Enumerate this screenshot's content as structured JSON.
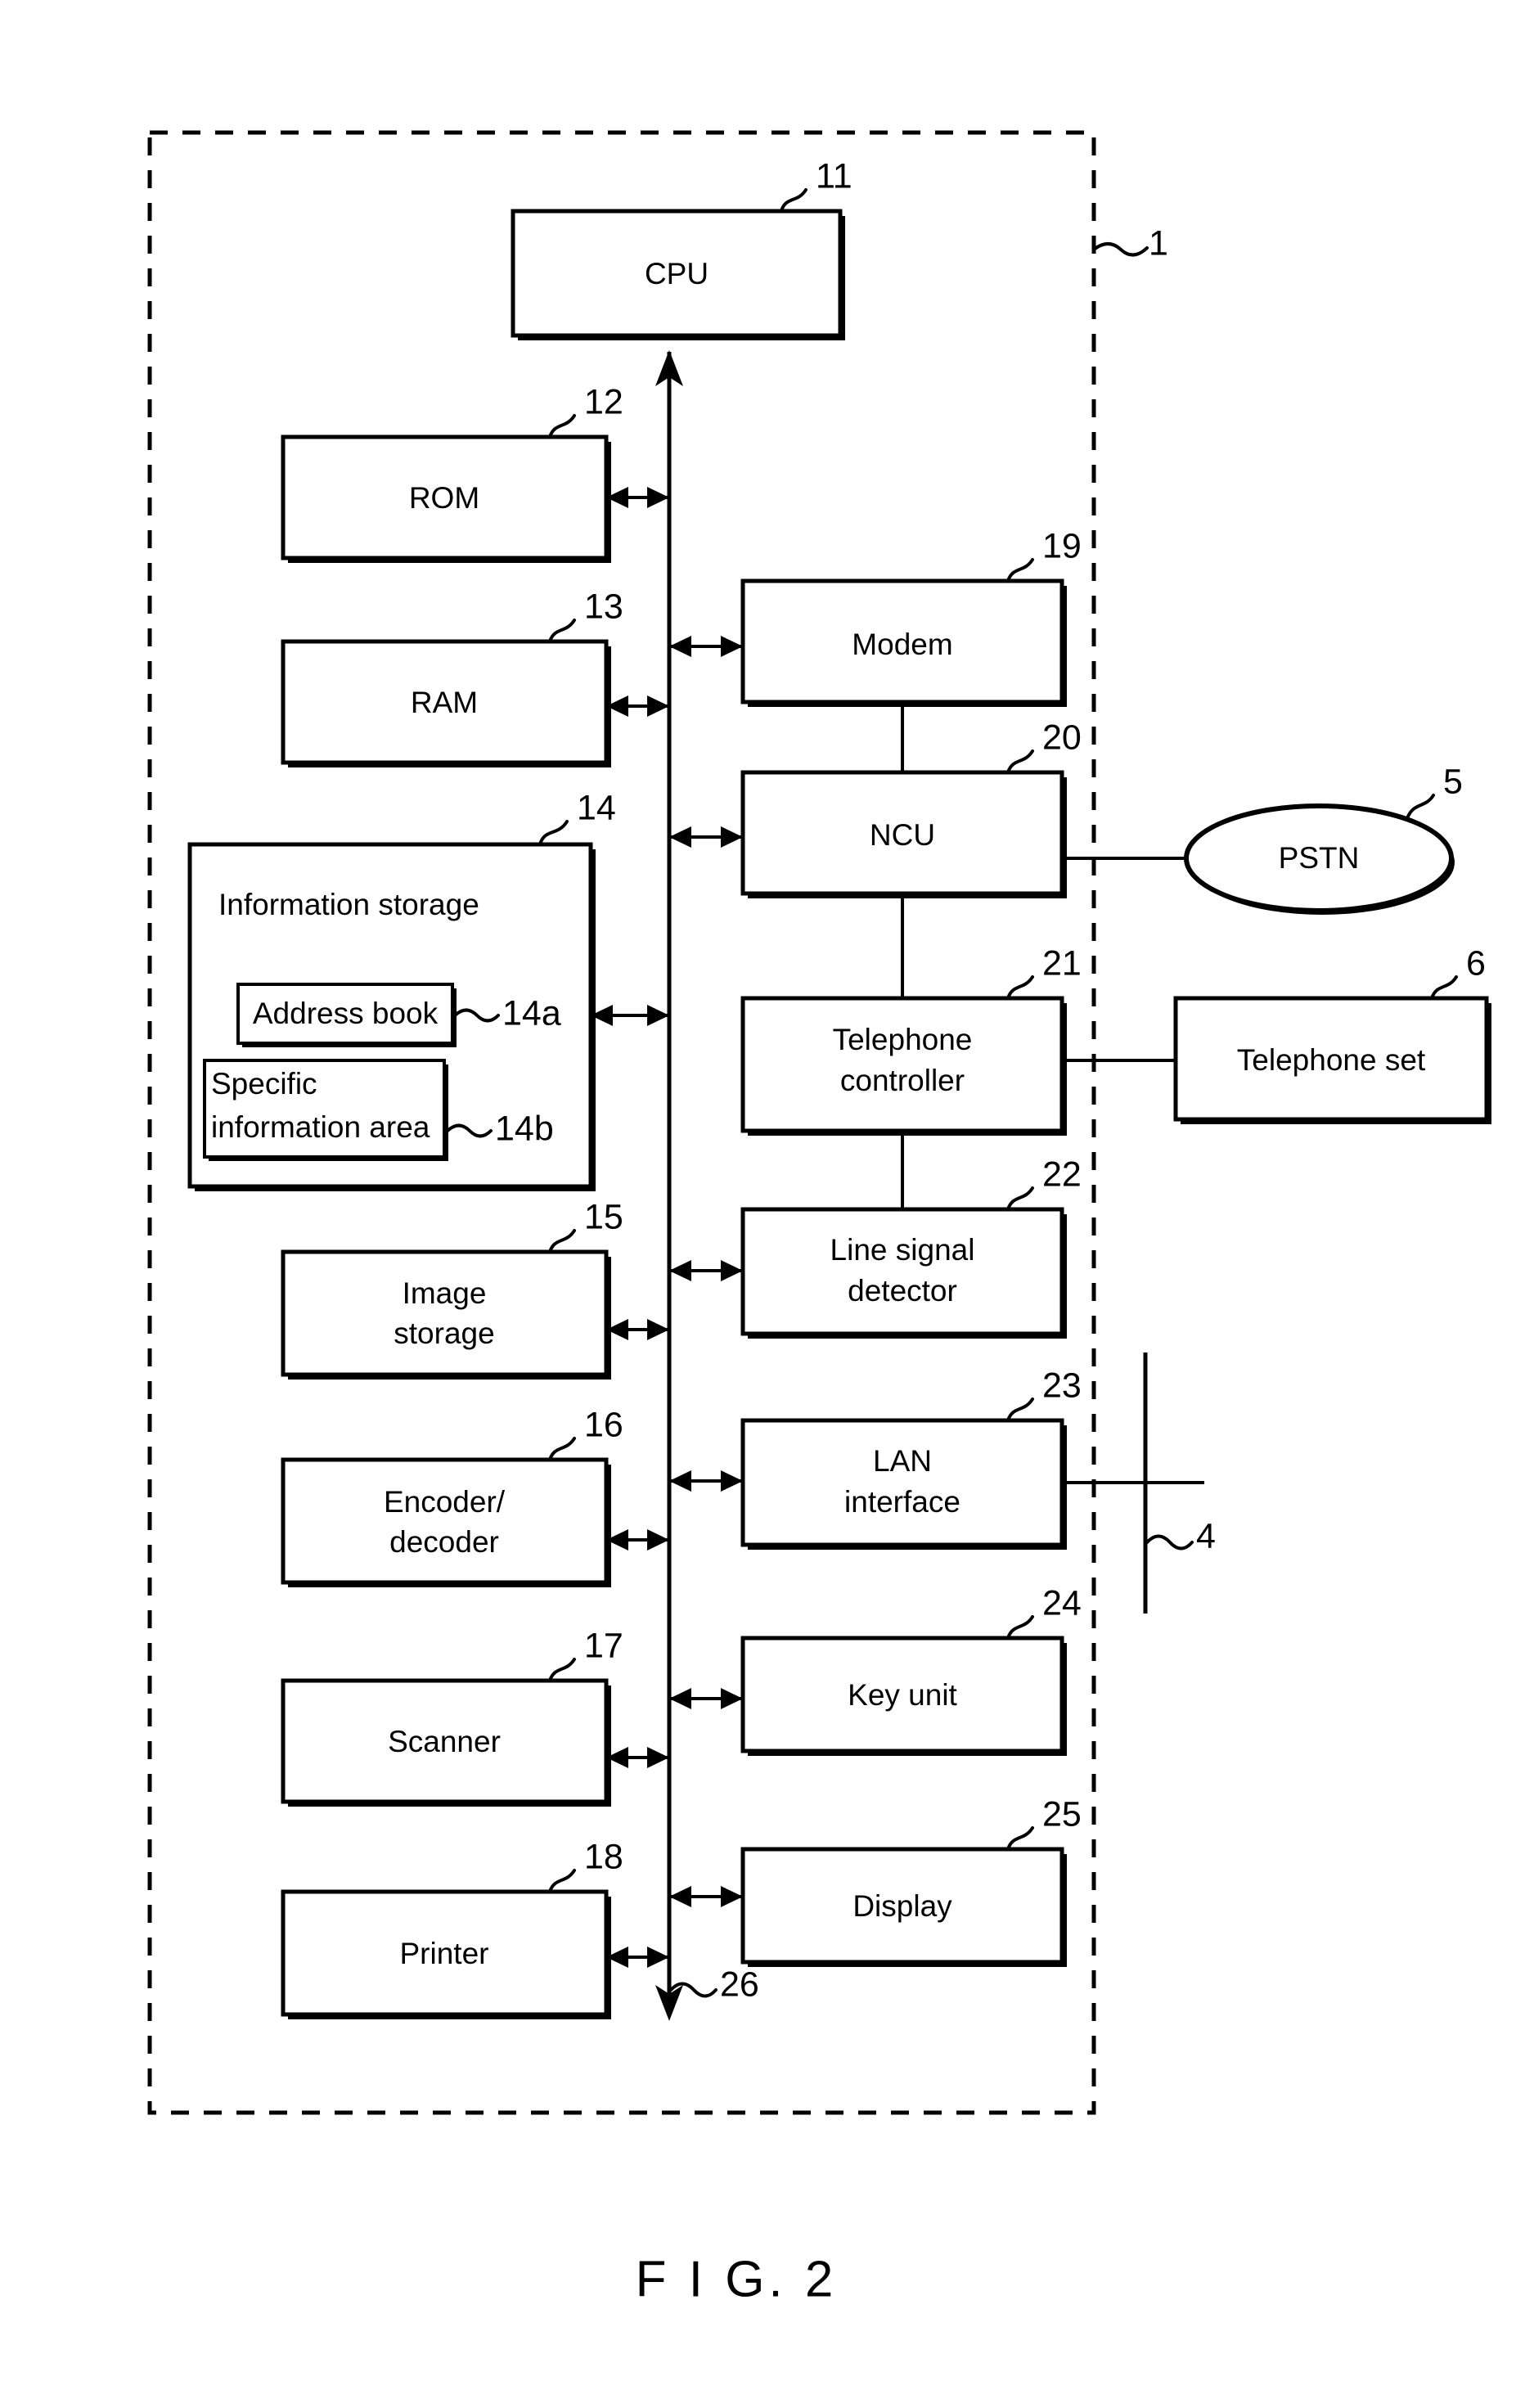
{
  "figure": {
    "caption": "F I G. 2",
    "device_ref": "1",
    "lan_ref": "4",
    "bus_ref": "26"
  },
  "blocks": {
    "cpu": {
      "label": "CPU",
      "ref": "11"
    },
    "rom": {
      "label": "ROM",
      "ref": "12"
    },
    "ram": {
      "label": "RAM",
      "ref": "13"
    },
    "info_store": {
      "label": "Information storage",
      "ref": "14"
    },
    "address_book": {
      "label": "Address book",
      "ref": "14a"
    },
    "specific_info": {
      "label_line1": "Specific",
      "label_line2": "information area",
      "ref": "14b"
    },
    "image_storage": {
      "label_line1": "Image",
      "label_line2": "storage",
      "ref": "15"
    },
    "encoder_decoder": {
      "label_line1": "Encoder/",
      "label_line2": "decoder",
      "ref": "16"
    },
    "scanner": {
      "label": "Scanner",
      "ref": "17"
    },
    "printer": {
      "label": "Printer",
      "ref": "18"
    },
    "modem": {
      "label": "Modem",
      "ref": "19"
    },
    "ncu": {
      "label": "NCU",
      "ref": "20"
    },
    "telephone_controller": {
      "label_line1": "Telephone",
      "label_line2": "controller",
      "ref": "21"
    },
    "line_signal_detector": {
      "label_line1": "Line signal",
      "label_line2": "detector",
      "ref": "22"
    },
    "lan_interface": {
      "label_line1": "LAN",
      "label_line2": "interface",
      "ref": "23"
    },
    "key_unit": {
      "label": "Key unit",
      "ref": "24"
    },
    "display": {
      "label": "Display",
      "ref": "25"
    },
    "pstn": {
      "label": "PSTN",
      "ref": "5"
    },
    "telephone_set": {
      "label": "Telephone set",
      "ref": "6"
    }
  }
}
